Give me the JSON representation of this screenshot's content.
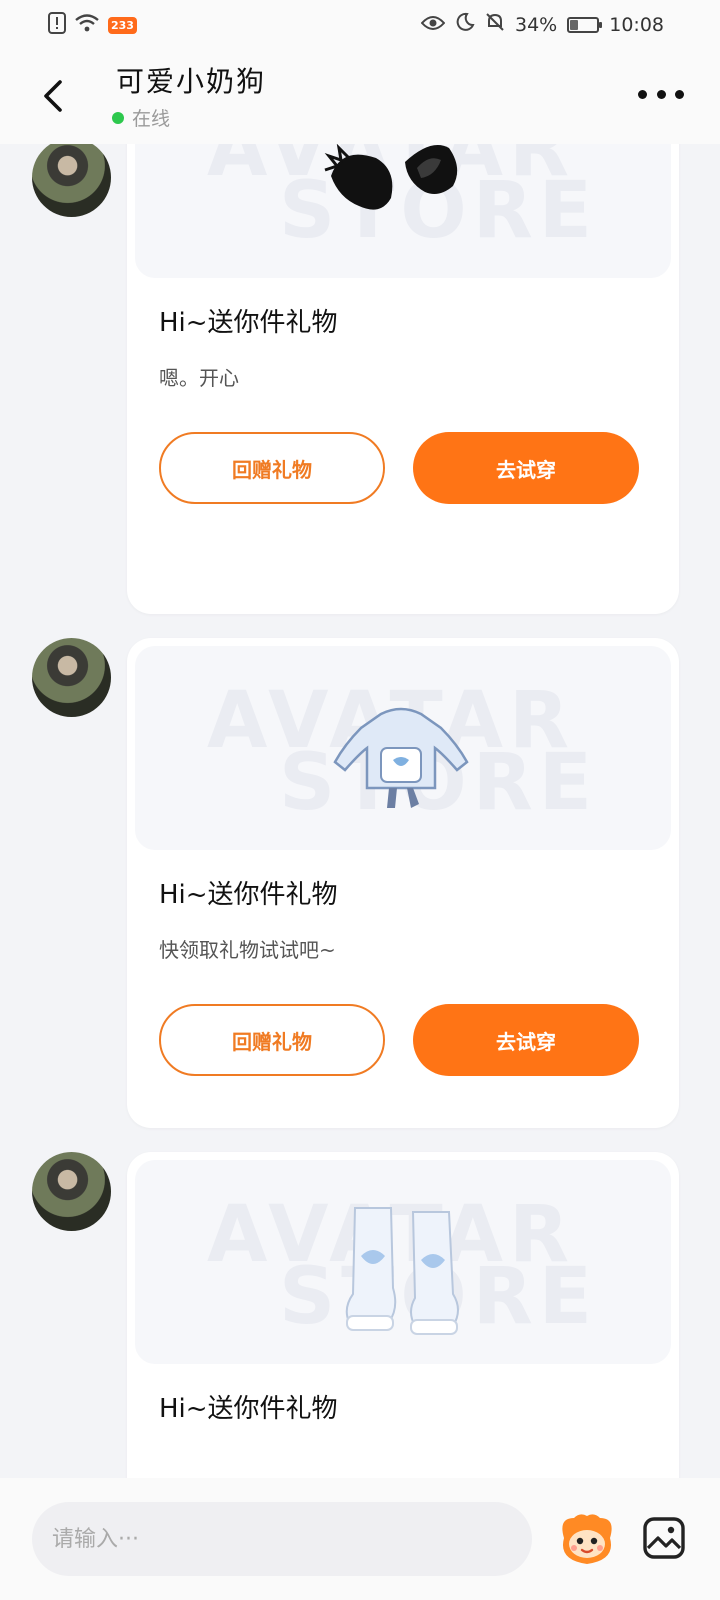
{
  "status_bar": {
    "badge": "233",
    "battery": "34%",
    "battery_level": 0.34,
    "time": "10:08"
  },
  "header": {
    "contact_name": "可爱小奶狗",
    "online_status": "在线"
  },
  "messages": [
    {
      "title": "Hi~送你件礼物",
      "text": "嗯。开心",
      "return_gift_label": "回赠礼物",
      "try_on_label": "去试穿",
      "item_icon": "cat-ears-icon"
    },
    {
      "title": "Hi~送你件礼物",
      "text": "快领取礼物试试吧~",
      "return_gift_label": "回赠礼物",
      "try_on_label": "去试穿",
      "item_icon": "jacket-icon"
    },
    {
      "title": "Hi~送你件礼物",
      "item_icon": "boots-icon"
    }
  ],
  "input": {
    "placeholder": "请输入···"
  },
  "colors": {
    "accent": "#ff7415",
    "online": "#2dc84d"
  }
}
